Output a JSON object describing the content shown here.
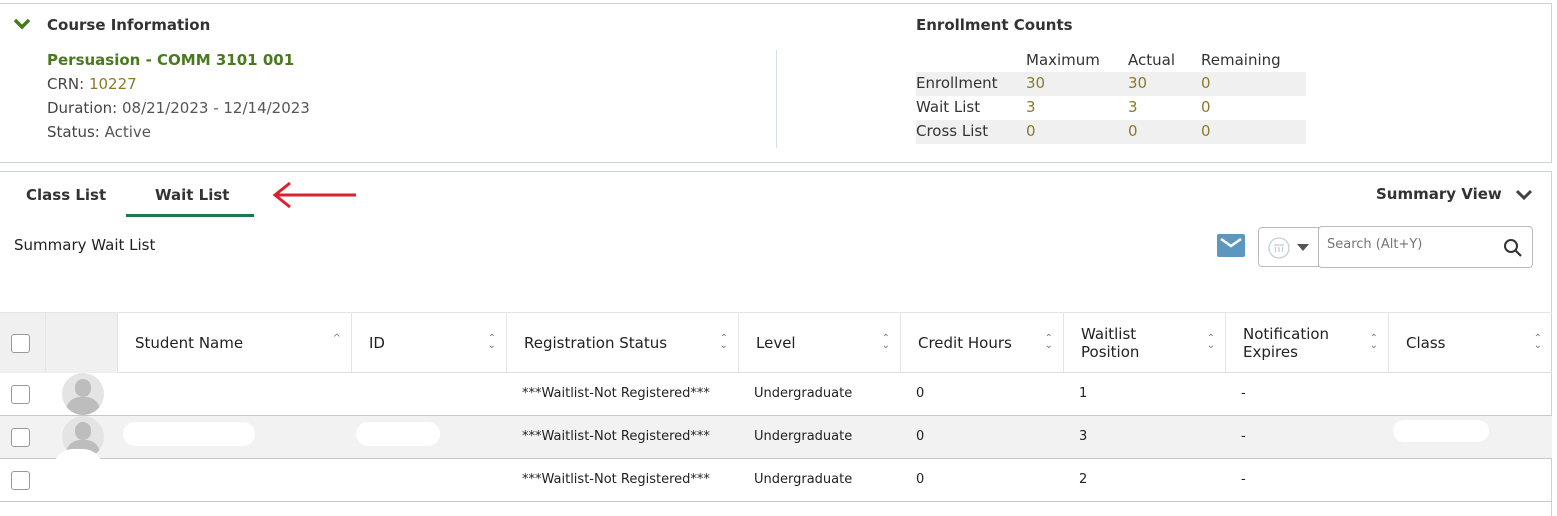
{
  "course_info": {
    "title": "Course Information",
    "course": "Persuasion - COMM 3101 001",
    "crn_label": "CRN:",
    "crn": "10227",
    "duration_label": "Duration:",
    "duration": "08/21/2023 - 12/14/2023",
    "status_label": "Status:",
    "status": "Active"
  },
  "enrollment": {
    "title": "Enrollment Counts",
    "headers": [
      "Maximum",
      "Actual",
      "Remaining"
    ],
    "rows": [
      {
        "label": "Enrollment",
        "values": [
          "30",
          "30",
          "0"
        ]
      },
      {
        "label": "Wait List",
        "values": [
          "3",
          "3",
          "0"
        ]
      },
      {
        "label": "Cross List",
        "values": [
          "0",
          "0",
          "0"
        ]
      }
    ]
  },
  "tabs": [
    {
      "label": "Class List"
    },
    {
      "label": "Wait List",
      "active": true
    }
  ],
  "summary_view": "Summary View",
  "section_title": "Summary Wait List",
  "search": {
    "placeholder": "Search (Alt+Y)"
  },
  "columns": [
    "Student Name",
    "ID",
    "Registration Status",
    "Level",
    "Credit Hours",
    "Waitlist Position",
    "Notification Expires",
    "Class"
  ],
  "rows": [
    {
      "status": "***Waitlist-Not Registered***",
      "level": "Undergraduate",
      "credit": "0",
      "position": "1",
      "expires": "-"
    },
    {
      "status": "***Waitlist-Not Registered***",
      "level": "Undergraduate",
      "credit": "0",
      "position": "3",
      "expires": "-"
    },
    {
      "status": "***Waitlist-Not Registered***",
      "level": "Undergraduate",
      "credit": "0",
      "position": "2",
      "expires": "-"
    }
  ],
  "colors": {
    "accent_green": "#1f7a4a",
    "course_green": "#4a7a1e",
    "mail_blue": "#5b97bf",
    "arrow_red": "#d9232e"
  }
}
